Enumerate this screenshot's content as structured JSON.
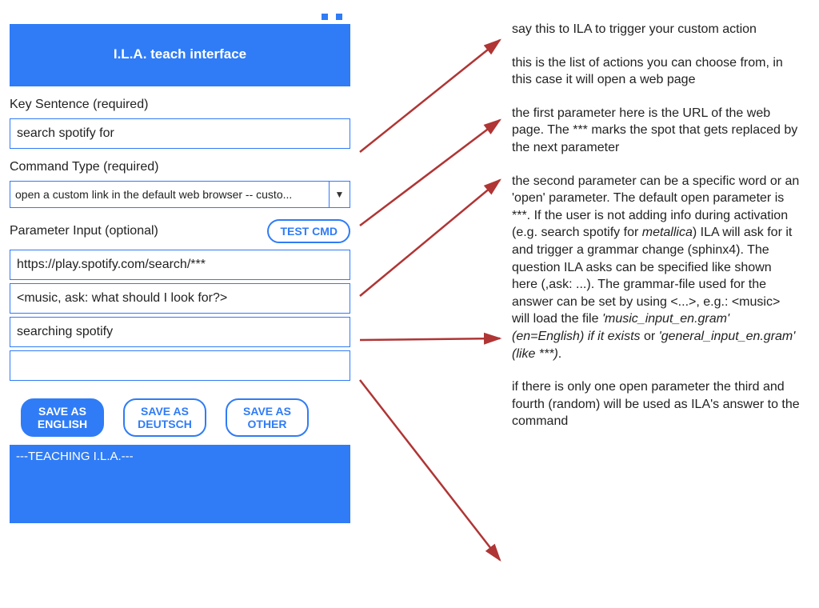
{
  "header": {
    "title": "I.L.A. teach interface"
  },
  "labels": {
    "key_sentence": "Key Sentence (required)",
    "command_type": "Command Type (required)",
    "param_input": "Parameter Input (optional)"
  },
  "fields": {
    "key_sentence": "search spotify for",
    "command_type": "open a custom link in the default web browser -- custo...",
    "param1": "https://play.spotify.com/search/***",
    "param2": "<music, ask: what should I look for?>",
    "param3": "searching spotify",
    "param4": ""
  },
  "buttons": {
    "test_cmd": "TEST CMD",
    "save_en": "SAVE AS ENGLISH",
    "save_de": "SAVE AS DEUTSCH",
    "save_other": "SAVE AS OTHER"
  },
  "log": "---TEACHING I.L.A.---",
  "annotations": {
    "a1": "say this to ILA to trigger your custom action",
    "a2": "this is the list of actions you can choose from, in this case it will open a web page",
    "a3": "the first parameter here is the URL of the web page. The *** marks the spot that gets replaced by the next parameter",
    "a4_pre": "the second parameter can be a specific word or an 'open' parameter. The default open parameter is ***. If the user is not adding info during activation (e.g. search spotify for ",
    "a4_em1": "metallica",
    "a4_mid": ") ILA will ask for it and trigger a grammar change (sphinx4). The question ILA asks can be specified like shown here (,ask: ...). The grammar-file used for the answer can be set by using <...>, e.g.: <music> will load the file ",
    "a4_em2": "'music_input_en.gram' (en=English) if it exists",
    "a4_post1": " or ",
    "a4_em3": "'general_input_en.gram' (like ***)",
    "a4_post2": ".",
    "a5": "if there is only one open parameter the third and fourth (random) will be used as ILA's answer to the command"
  },
  "colors": {
    "accent": "#2f7cf6",
    "arrow": "#b03535"
  }
}
